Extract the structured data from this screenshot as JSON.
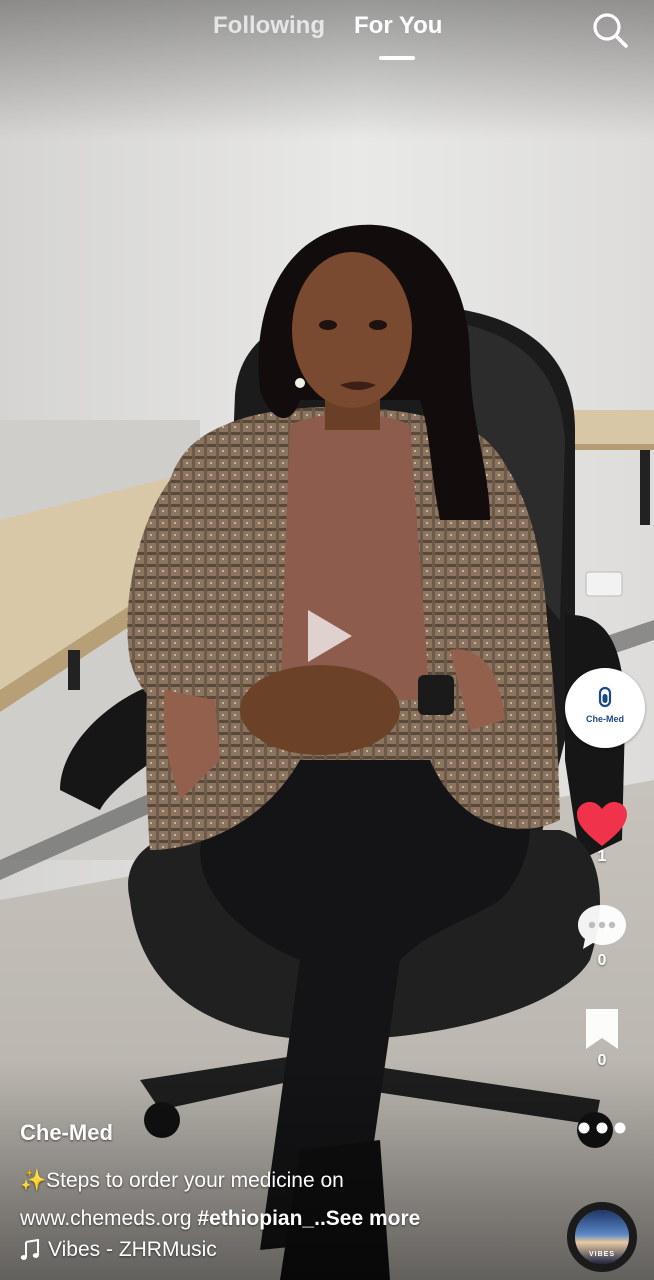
{
  "nav": {
    "following_label": "Following",
    "for_you_label": "For You"
  },
  "profile": {
    "avatar_text": "Che-Med"
  },
  "actions": {
    "likes_count": "1",
    "comments_count": "0",
    "saves_count": "0"
  },
  "post": {
    "username": "Che-Med",
    "sparkle": "✨",
    "caption_line1": "Steps to order your medicine on",
    "caption_url": "www.chemeds.org",
    "hashtag": "#ethiopian_",
    "see_more": "..See more",
    "music": "Vibes - ZHRMusic",
    "disc_text": "VIBES"
  },
  "colors": {
    "like": "#f0334b",
    "accent": "#ffffff"
  }
}
